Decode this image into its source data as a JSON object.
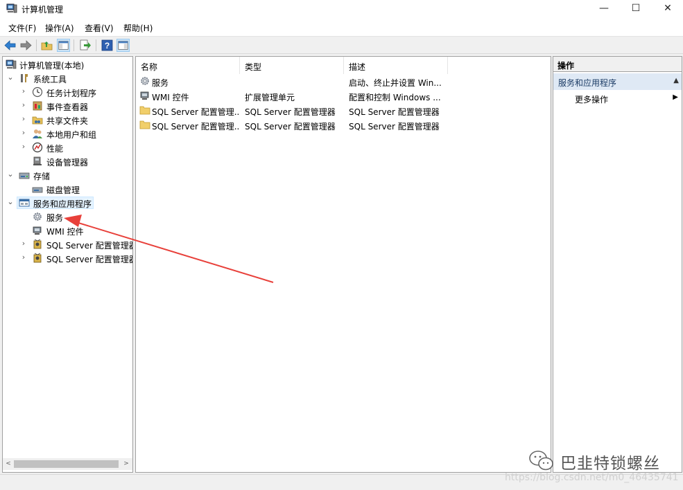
{
  "window": {
    "title": "计算机管理",
    "min_glyph": "—",
    "max_glyph": "☐",
    "close_glyph": "✕"
  },
  "menu": [
    "文件(F)",
    "操作(A)",
    "查看(V)",
    "帮助(H)"
  ],
  "toolbar": {
    "buttons": [
      "back-icon",
      "forward-icon",
      "up-folder-icon",
      "show-hide-tree-icon",
      "export-list-icon",
      "help-icon",
      "show-hide-action-pane-icon"
    ]
  },
  "tree": {
    "root": "计算机管理(本地)",
    "items": [
      {
        "label": "系统工具",
        "expanded": true
      },
      {
        "label": "任务计划程序"
      },
      {
        "label": "事件查看器"
      },
      {
        "label": "共享文件夹"
      },
      {
        "label": "本地用户和组"
      },
      {
        "label": "性能"
      },
      {
        "label": "设备管理器"
      },
      {
        "label": "存储",
        "expanded": true
      },
      {
        "label": "磁盘管理"
      },
      {
        "label": "服务和应用程序",
        "expanded": true,
        "selected": true
      },
      {
        "label": "服务"
      },
      {
        "label": "WMI 控件"
      },
      {
        "label": "SQL Server 配置管理器"
      },
      {
        "label": "SQL Server 配置管理器"
      }
    ],
    "expand_glyph": "›",
    "collapse_glyph": "⌄"
  },
  "list": {
    "columns": [
      "名称",
      "类型",
      "描述"
    ],
    "rows": [
      {
        "name": "服务",
        "type": "",
        "desc": "启动、终止并设置 Win..."
      },
      {
        "name": "WMI 控件",
        "type": "扩展管理单元",
        "desc": "配置和控制 Windows ..."
      },
      {
        "name": "SQL Server 配置管理...",
        "type": "SQL Server 配置管理器",
        "desc": "SQL Server 配置管理器"
      },
      {
        "name": "SQL Server 配置管理...",
        "type": "SQL Server 配置管理器",
        "desc": "SQL Server 配置管理器"
      }
    ]
  },
  "actions": {
    "header": "操作",
    "section": "服务和应用程序",
    "section_arrow": "▲",
    "item": "更多操作",
    "item_arrow": "▶"
  },
  "scroll": {
    "left_arrow": "<",
    "right_arrow": ">"
  },
  "watermark": {
    "name": "巴韭特锁螺丝",
    "url": "https://blog.csdn.net/m0_46435741"
  },
  "colors": {
    "annotation_arrow": "#e8403a",
    "selection": "#e5f3ff",
    "action_section": "#dfe9f5"
  }
}
